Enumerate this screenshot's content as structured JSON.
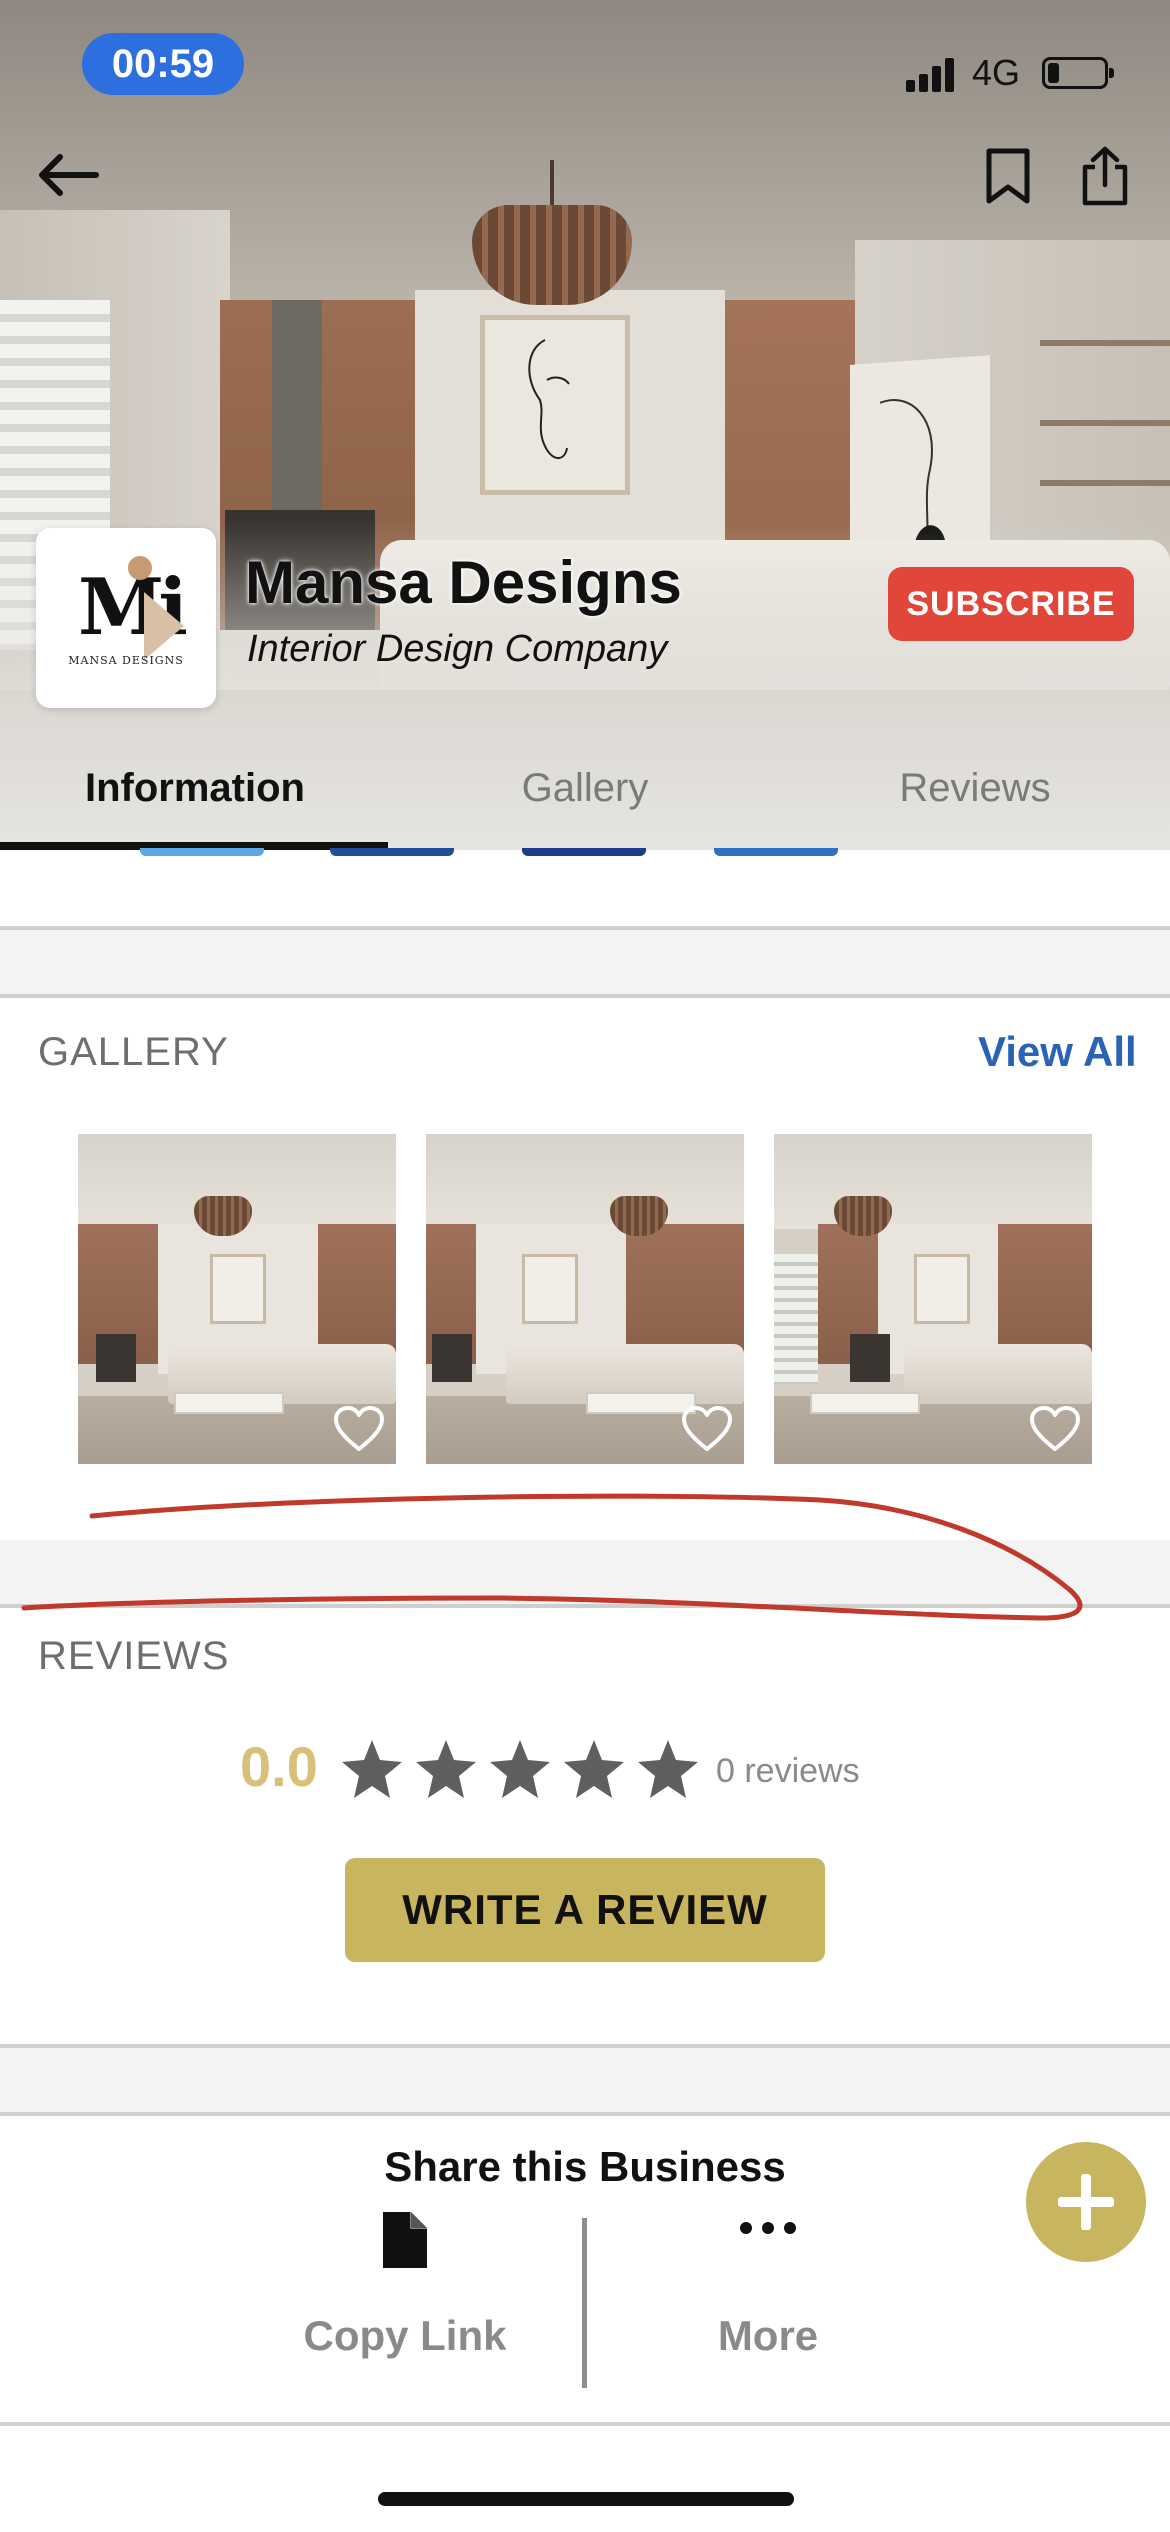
{
  "status_bar": {
    "time": "00:59",
    "network": "4G",
    "battery_level_fraction": 0.2
  },
  "header": {
    "back_icon": "back-arrow-icon",
    "bookmark_icon": "bookmark-icon",
    "share_icon": "share-icon"
  },
  "business": {
    "logo_letters": "Mi",
    "logo_caption": "MANSA DESIGNS",
    "name": "Mansa Designs",
    "type": "Interior Design Company",
    "subscribe_label": "SUBSCRIBE"
  },
  "tabs": [
    {
      "label": "Information",
      "active": true
    },
    {
      "label": "Gallery",
      "active": false
    },
    {
      "label": "Reviews",
      "active": false
    }
  ],
  "gallery": {
    "title": "GALLERY",
    "view_all_label": "View All",
    "items": [
      {
        "favorite_icon": "heart-outline-icon"
      },
      {
        "favorite_icon": "heart-outline-icon"
      },
      {
        "favorite_icon": "heart-outline-icon"
      }
    ]
  },
  "reviews": {
    "title": "REVIEWS",
    "rating": "0.0",
    "stars_filled": 0,
    "stars_total": 5,
    "count_label": "0 reviews",
    "write_review_label": "WRITE A REVIEW"
  },
  "share": {
    "title": "Share this Business",
    "copy_link_label": "Copy Link",
    "copy_link_icon": "document-icon",
    "more_label": "More",
    "more_icon": "ellipsis-icon",
    "fab_icon": "plus-icon"
  },
  "colors": {
    "accent_gold": "#c8b560",
    "rating_gold": "#d8c07a",
    "subscribe_red": "#e0463a",
    "link_blue": "#2a63b5",
    "time_pill_blue": "#2e6fe0",
    "annotation_red": "#c0392b"
  }
}
